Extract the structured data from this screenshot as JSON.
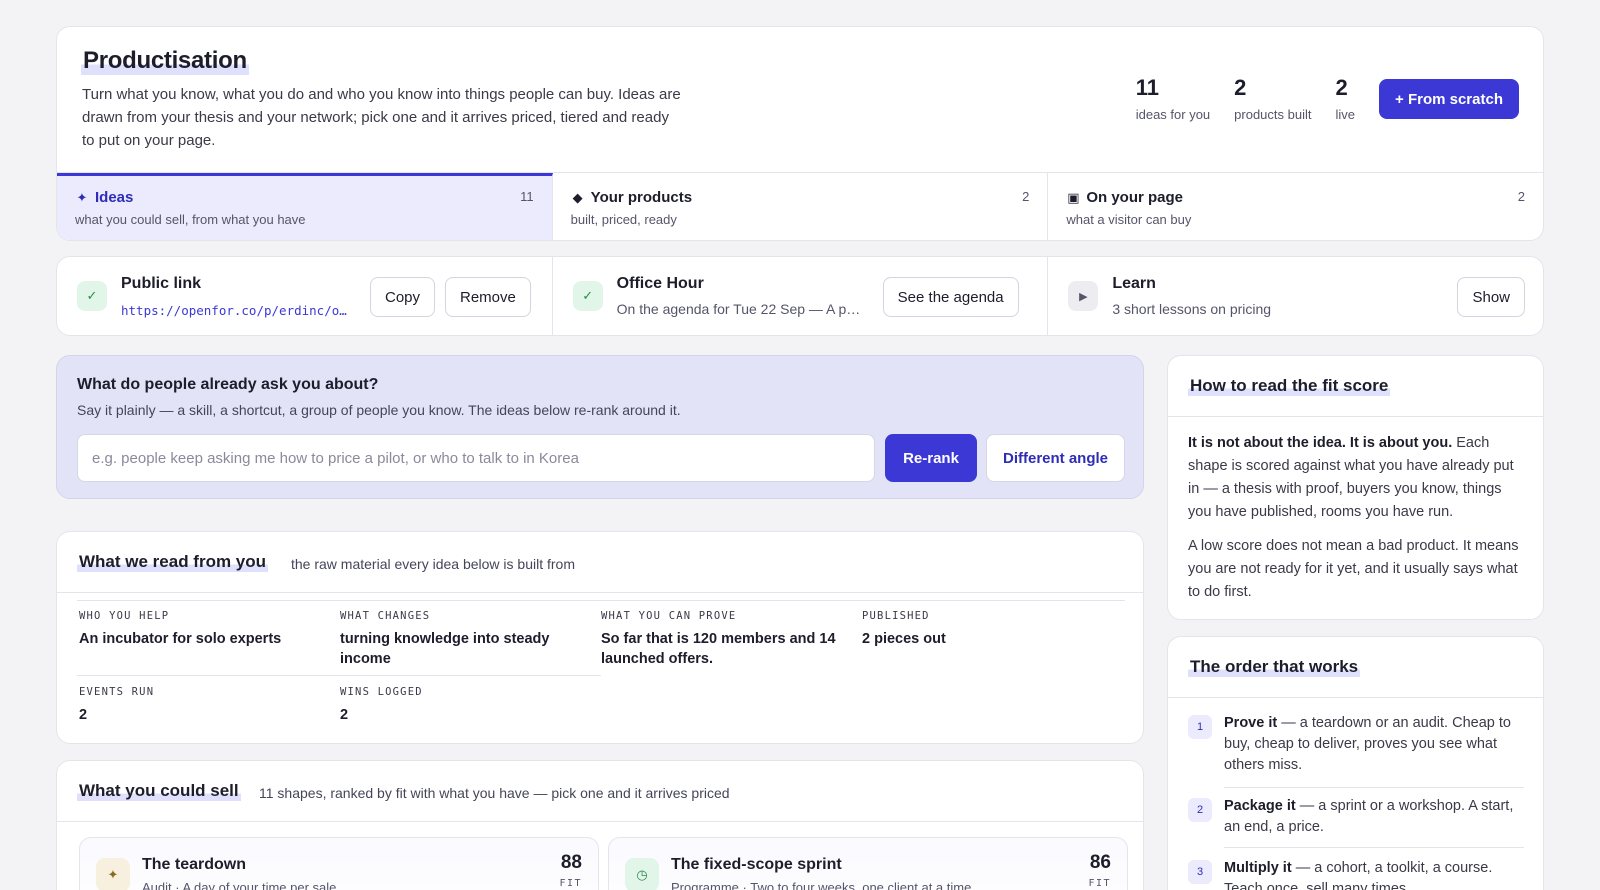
{
  "header": {
    "title": "Productisation",
    "description": "Turn what you know, what you do and who you know into things people can buy. Ideas are drawn from your thesis and your network; pick one and it arrives priced, tiered and ready to put on your page.",
    "stats": [
      {
        "value": "11",
        "label": "ideas for you"
      },
      {
        "value": "2",
        "label": "products built"
      },
      {
        "value": "2",
        "label": "live"
      }
    ],
    "primary_button": "+ From scratch"
  },
  "tabs": [
    {
      "icon": "sparkle-icon",
      "glyph": "✦",
      "label": "Ideas",
      "sub": "what you could sell, from what you have",
      "count": "11",
      "active": true
    },
    {
      "icon": "diamond-icon",
      "glyph": "◆",
      "label": "Your products",
      "sub": "built, priced, ready",
      "count": "2",
      "active": false
    },
    {
      "icon": "page-icon",
      "glyph": "▣",
      "label": "On your page",
      "sub": "what a visitor can buy",
      "count": "2",
      "active": false
    }
  ],
  "status": {
    "public_link": {
      "title": "Public link",
      "url": "https://openfor.co/p/erdinc/o…",
      "copy": "Copy",
      "remove": "Remove"
    },
    "office_hour": {
      "title": "Office Hour",
      "sub": "On the agenda for Tue 22 Sep — A p…",
      "button": "See the agenda"
    },
    "learn": {
      "title": "Learn",
      "sub": "3 short lessons on pricing",
      "button": "Show"
    }
  },
  "ask": {
    "question": "What do people already ask you about?",
    "hint": "Say it plainly — a skill, a shortcut, a group of people you know. The ideas below re-rank around it.",
    "placeholder": "e.g. people keep asking me how to price a pilot, or who to talk to in Korea",
    "value": "",
    "rerank": "Re-rank",
    "angle": "Different angle"
  },
  "read": {
    "title": "What we read from you",
    "sub": "the raw material every idea below is built from",
    "facts": [
      {
        "label": "WHO YOU HELP",
        "value": "An incubator for solo experts"
      },
      {
        "label": "WHAT CHANGES",
        "value": "turning knowledge into steady income"
      },
      {
        "label": "WHAT YOU CAN PROVE",
        "value": "So far that is 120 members and 14 launched offers."
      },
      {
        "label": "PUBLISHED",
        "value": "2 pieces out"
      },
      {
        "label": "EVENTS RUN",
        "value": "2"
      },
      {
        "label": "WINS LOGGED",
        "value": "2"
      }
    ]
  },
  "sell": {
    "title": "What you could sell",
    "sub": "11 shapes, ranked by fit with what you have — pick one and it arrives priced",
    "ideas": [
      {
        "icon": "sparkle-icon",
        "glyph": "✦",
        "title": "The teardown",
        "sub": "Audit · A day of your time per sale",
        "score": "88",
        "fit": "FIT",
        "accent": "#f7f0df",
        "accent_fg": "#8a6a1f"
      },
      {
        "icon": "clock-icon",
        "glyph": "◷",
        "title": "The fixed-scope sprint",
        "sub": "Programme · Two to four weeks, one client at a time",
        "score": "86",
        "fit": "FIT",
        "accent": "#e1f5e8",
        "accent_fg": "#2d8a4f"
      }
    ]
  },
  "fit_card": {
    "title": "How to read the fit score",
    "p1_bold": "It is not about the idea. It is about you.",
    "p1_rest": " Each shape is scored against what you have already put in — a thesis with proof, buyers you know, things you have published, rooms you have run.",
    "p2": "A low score does not mean a bad product. It means you are not ready for it yet, and it usually says what to do first."
  },
  "order_card": {
    "title": "The order that works",
    "steps": [
      {
        "n": "1",
        "bold": "Prove it",
        "rest": " — a teardown or an audit. Cheap to buy, cheap to deliver, proves you see what others miss."
      },
      {
        "n": "2",
        "bold": "Package it",
        "rest": " — a sprint or a workshop. A start, an end, a price."
      },
      {
        "n": "3",
        "bold": "Multiply it",
        "rest": " — a cohort, a toolkit, a course. Teach once, sell many times."
      }
    ]
  },
  "colors": {
    "accent": "#3b38d6",
    "accent_soft": "#ebebfd",
    "ok": "#2d8a4f"
  }
}
